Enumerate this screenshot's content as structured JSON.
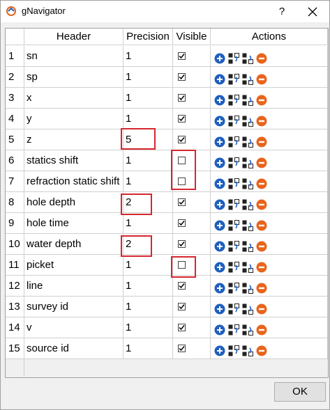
{
  "window": {
    "title": "gNavigator",
    "help_label": "?",
    "ok_label": "OK"
  },
  "table": {
    "columns": [
      "Header",
      "Precision",
      "Visible",
      "Actions"
    ],
    "rows": [
      {
        "num": "1",
        "header": "sn",
        "precision": "1",
        "visible": true
      },
      {
        "num": "2",
        "header": "sp",
        "precision": "1",
        "visible": true
      },
      {
        "num": "3",
        "header": "x",
        "precision": "1",
        "visible": true
      },
      {
        "num": "4",
        "header": "y",
        "precision": "1",
        "visible": true
      },
      {
        "num": "5",
        "header": "z",
        "precision": "5",
        "visible": true
      },
      {
        "num": "6",
        "header": "statics shift",
        "precision": "1",
        "visible": false
      },
      {
        "num": "7",
        "header": "refraction static shift",
        "precision": "1",
        "visible": false
      },
      {
        "num": "8",
        "header": "hole depth",
        "precision": "2",
        "visible": true
      },
      {
        "num": "9",
        "header": "hole time",
        "precision": "1",
        "visible": true
      },
      {
        "num": "10",
        "header": "water depth",
        "precision": "2",
        "visible": true
      },
      {
        "num": "11",
        "header": "picket",
        "precision": "1",
        "visible": false
      },
      {
        "num": "12",
        "header": "line",
        "precision": "1",
        "visible": true
      },
      {
        "num": "13",
        "header": "survey id",
        "precision": "1",
        "visible": true
      },
      {
        "num": "14",
        "header": "v",
        "precision": "1",
        "visible": true
      },
      {
        "num": "15",
        "header": "source id",
        "precision": "1",
        "visible": true
      }
    ],
    "actions": [
      "add-icon",
      "move-up-icon",
      "move-down-icon",
      "remove-icon"
    ]
  },
  "colors": {
    "highlight": "#d6262f",
    "add": "#1f5fbf",
    "remove": "#e8641b"
  }
}
